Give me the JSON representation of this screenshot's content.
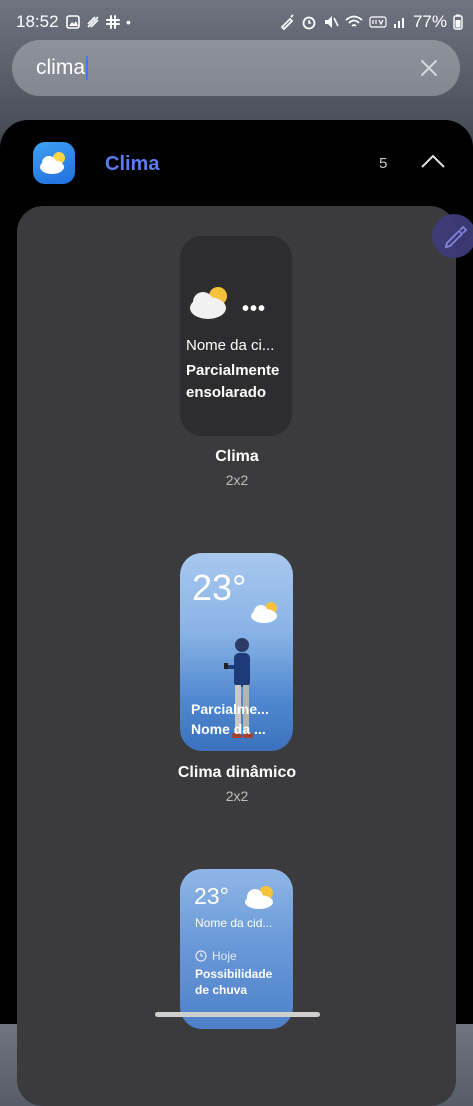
{
  "status_bar": {
    "time": "18:52",
    "battery": "77%"
  },
  "search": {
    "value": "clima"
  },
  "results": {
    "app_name": "Clima",
    "count": "5"
  },
  "widgets": [
    {
      "name": "Clima",
      "size": "2x2",
      "city": "Nome da ci...",
      "condition": "Parcialmente ensolarado"
    },
    {
      "name": "Clima dinâmico",
      "size": "2x2",
      "temperature": "23°",
      "condition_line1": "Parcialme...",
      "condition_line2": "Nome da ..."
    },
    {
      "temperature": "23°",
      "city": "Nome da cid...",
      "today": "Hoje",
      "forecast": "Possibilidade de chuva"
    }
  ],
  "colors": {
    "accent": "#5a7cf2",
    "panel": "#000000",
    "card": "#3b3b3d"
  }
}
